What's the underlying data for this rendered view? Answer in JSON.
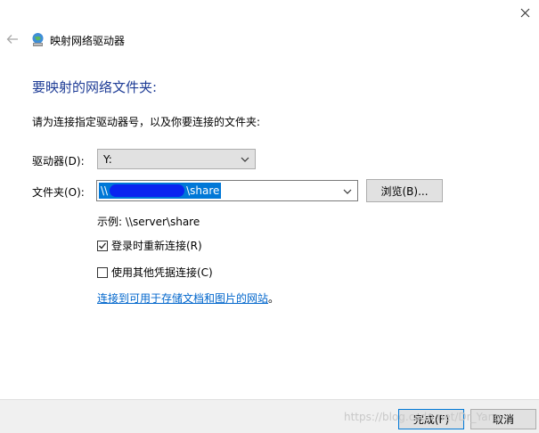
{
  "window": {
    "title": "映射网络驱动器",
    "close_glyph": "✕"
  },
  "main": {
    "heading": "要映射的网络文件夹:",
    "instruction": "请为连接指定驱动器号，以及你要连接的文件夹:"
  },
  "drive": {
    "label": "驱动器(D):",
    "value": "Y:"
  },
  "folder": {
    "label": "文件夹(O):",
    "value_prefix": "\\\\",
    "value_suffix": "\\share",
    "browse_label": "浏览(B)..."
  },
  "example": "示例: \\\\server\\share",
  "options": {
    "reconnect_label": "登录时重新连接(R)",
    "reconnect_checked": true,
    "other_credentials_label": "使用其他凭据连接(C)",
    "other_credentials_checked": false
  },
  "link": {
    "text": "连接到可用于存储文档和图片的网站",
    "suffix": "。"
  },
  "footer": {
    "finish_label": "完成(F)",
    "cancel_label": "取消",
    "watermark": "https://blog.csdn.net/Dr_Yang"
  },
  "colors": {
    "accent": "#0078d7",
    "heading": "#1e3c96",
    "link": "#0066cc"
  },
  "icons": {
    "back": "back-arrow-icon",
    "title": "network-drive-icon",
    "close": "close-icon",
    "dropdown": "chevron-down-icon",
    "check": "checkmark-icon"
  }
}
